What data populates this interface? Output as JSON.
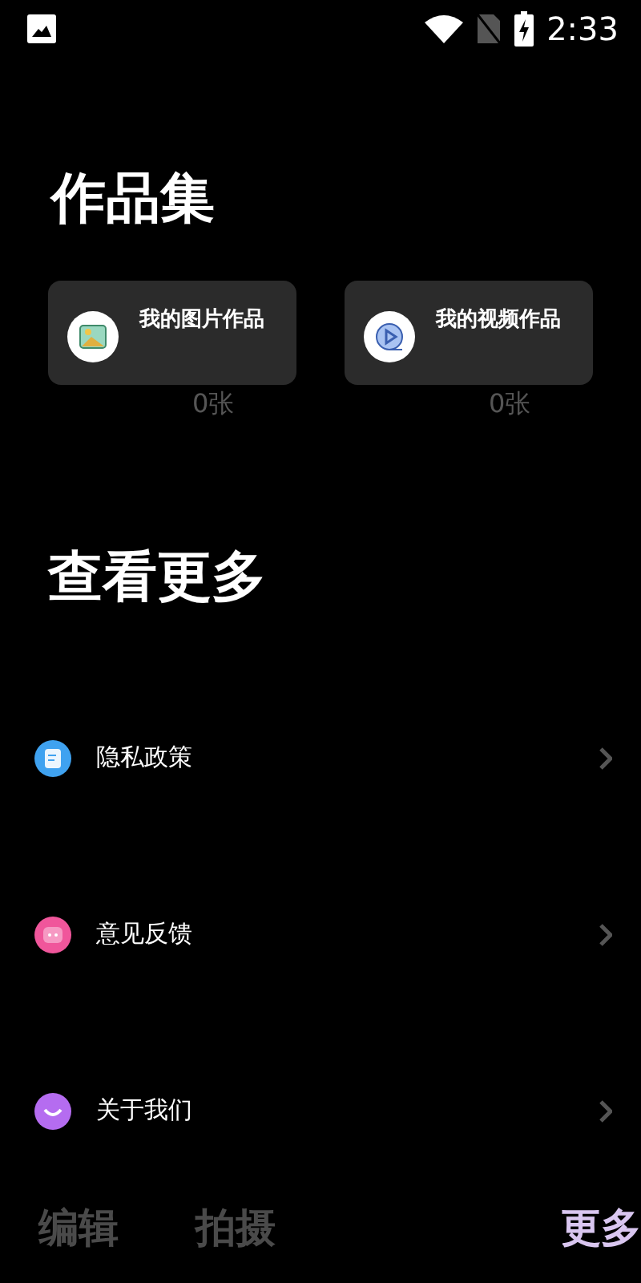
{
  "status_bar": {
    "time": "2:33"
  },
  "works": {
    "title": "作品集",
    "cards": [
      {
        "kind": "image",
        "label": "我的图片作品",
        "count": "0张"
      },
      {
        "kind": "video",
        "label": "我的视频作品",
        "count": "0张"
      }
    ]
  },
  "more": {
    "title": "查看更多",
    "items": [
      {
        "kind": "doc",
        "label": "隐私政策",
        "color": "#3fa2f0"
      },
      {
        "kind": "chat",
        "label": "意见反馈",
        "color": "#f0569b"
      },
      {
        "kind": "smile",
        "label": "关于我们",
        "color": "#b56cf0"
      }
    ]
  },
  "tabs": [
    {
      "label": "编辑",
      "selected": false
    },
    {
      "label": "拍摄",
      "selected": false
    },
    {
      "label": "更多",
      "selected": true
    }
  ]
}
